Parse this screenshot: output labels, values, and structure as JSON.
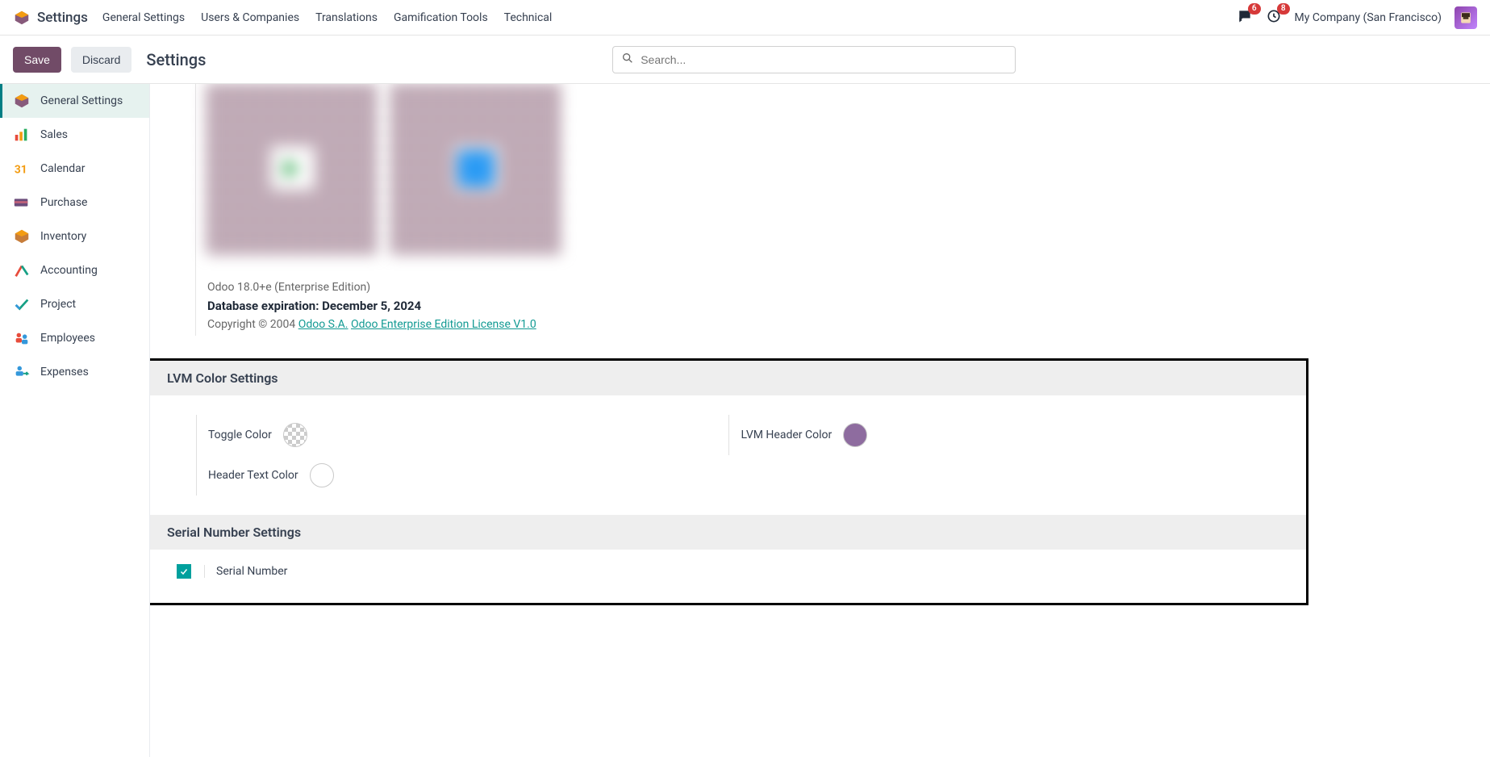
{
  "header": {
    "app_title": "Settings",
    "nav": [
      "General Settings",
      "Users & Companies",
      "Translations",
      "Gamification Tools",
      "Technical"
    ],
    "messages_badge": "6",
    "activities_badge": "8",
    "company": "My Company (San Francisco)"
  },
  "control": {
    "save": "Save",
    "discard": "Discard",
    "breadcrumb": "Settings",
    "search_placeholder": "Search..."
  },
  "sidebar": {
    "items": [
      {
        "label": "General Settings",
        "icon": "odoo"
      },
      {
        "label": "Sales",
        "icon": "bars"
      },
      {
        "label": "Calendar",
        "icon": "cal31"
      },
      {
        "label": "Purchase",
        "icon": "card"
      },
      {
        "label": "Inventory",
        "icon": "box"
      },
      {
        "label": "Accounting",
        "icon": "chartx"
      },
      {
        "label": "Project",
        "icon": "check"
      },
      {
        "label": "Employees",
        "icon": "people"
      },
      {
        "label": "Expenses",
        "icon": "expense"
      }
    ]
  },
  "version": {
    "line": "Odoo 18.0+e (Enterprise Edition)",
    "db_expiration": "Database expiration: December 5, 2024",
    "copyright_prefix": "Copyright © 2004 ",
    "link1": "Odoo S.A.",
    "link2": "Odoo Enterprise Edition License V1.0"
  },
  "lvm_section": {
    "title": "LVM Color Settings",
    "toggle_label": "Toggle Color",
    "header_text_label": "Header Text Color",
    "lvm_header_label": "LVM Header Color",
    "toggle_color": "transparent",
    "header_text_color": "#ffffff",
    "lvm_header_color": "#8e6c9f"
  },
  "serial_section": {
    "title": "Serial Number Settings",
    "checkbox_checked": true,
    "label": "Serial Number"
  }
}
